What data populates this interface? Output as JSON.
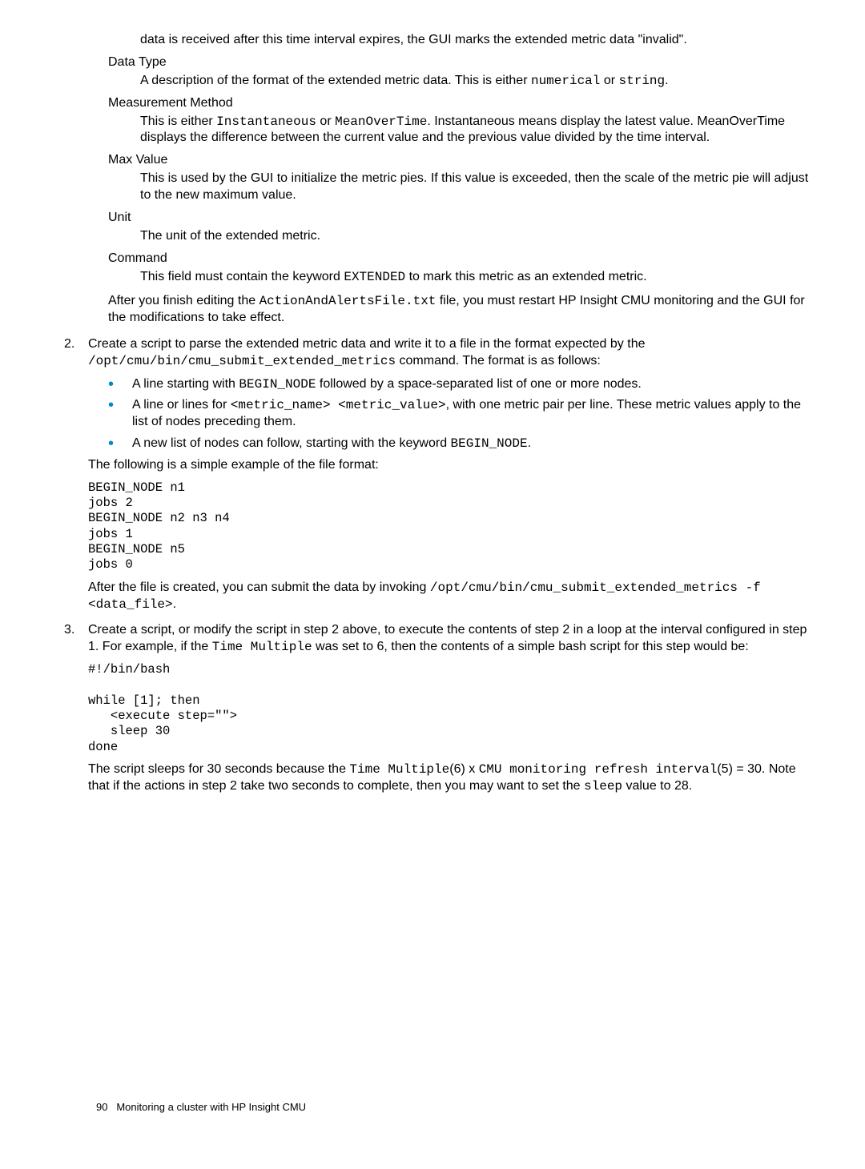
{
  "para_top": "data is received after this time interval expires, the GUI marks the extended metric data \"invalid\".",
  "terms": {
    "data_type": {
      "label": "Data Type",
      "def_pre": "A description of the format of the extended metric data. This is either ",
      "code1": "numerical",
      "mid": " or ",
      "code2": "string",
      "post": "."
    },
    "measurement": {
      "label": "Measurement Method",
      "def_pre": "This is either ",
      "code1": "Instantaneous",
      "mid": " or ",
      "code2": "MeanOverTime",
      "post": ". Instantaneous means display the latest value. MeanOverTime displays the difference between the current value and the previous value divided by the time interval."
    },
    "max_value": {
      "label": "Max Value",
      "def": "This is used by the GUI to initialize the metric pies. If this value is exceeded, then the scale of the metric pie will adjust to the new maximum value."
    },
    "unit": {
      "label": "Unit",
      "def": "The unit of the extended metric."
    },
    "command": {
      "label": "Command",
      "def_pre": "This field must contain the keyword ",
      "code1": "EXTENDED",
      "post": " to mark this metric as an extended metric."
    }
  },
  "after_terms": {
    "pre": "After you finish editing the ",
    "code1": "ActionAndAlertsFile.txt",
    "post": " file, you must restart HP Insight CMU monitoring and the GUI for the modifications to take effect."
  },
  "step2": {
    "num": "2.",
    "pre": "Create a script to parse the extended metric data and write it to a file in the format expected by the ",
    "code1": "/opt/cmu/bin/cmu_submit_extended_metrics",
    "post": " command. The format is as follows:",
    "bullets": {
      "b1": {
        "pre": "A line starting with ",
        "code1": "BEGIN_NODE",
        "post": " followed by a space-separated list of one or more nodes."
      },
      "b2": {
        "pre": "A line or lines for ",
        "code1": "<metric_name> <metric_value>",
        "post": ", with one metric pair per line. These metric values apply to the list of nodes preceding them."
      },
      "b3": {
        "pre": "A new list of nodes can follow, starting with the keyword ",
        "code1": "BEGIN_NODE",
        "post": "."
      }
    },
    "intro_example": "The following is a simple example of the file format:",
    "code_example": "BEGIN_NODE n1\njobs 2\nBEGIN_NODE n2 n3 n4\njobs 1\nBEGIN_NODE n5\njobs 0",
    "after_example": {
      "pre": "After the file is created, you can submit the data by invoking ",
      "code1": "/opt/cmu/bin/cmu_submit_extended_metrics -f <data_file>",
      "post": "."
    }
  },
  "step3": {
    "num": "3.",
    "pre": "Create a script, or modify the script in step 2 above, to execute the contents of step 2 in a loop at the interval configured in step 1. For example, if the ",
    "code1": "Time Multiple",
    "post": " was set to 6, then the contents of a simple bash script for this step would be:",
    "code_block": "#!/bin/bash\n\nwhile [1]; then\n   <execute step=\"\">\n   sleep 30\ndone",
    "after": {
      "pre": "The script sleeps for 30 seconds because the ",
      "code1": "Time Multiple",
      "mid1": "(6) x ",
      "code2": "CMU monitoring refresh interval",
      "mid2": "(5) = 30. Note that if the actions in step 2 take two seconds to complete, then you may want to set the ",
      "code3": "sleep",
      "post": " value to 28."
    }
  },
  "footer": {
    "page": "90",
    "title": "Monitoring a cluster with HP Insight CMU"
  }
}
